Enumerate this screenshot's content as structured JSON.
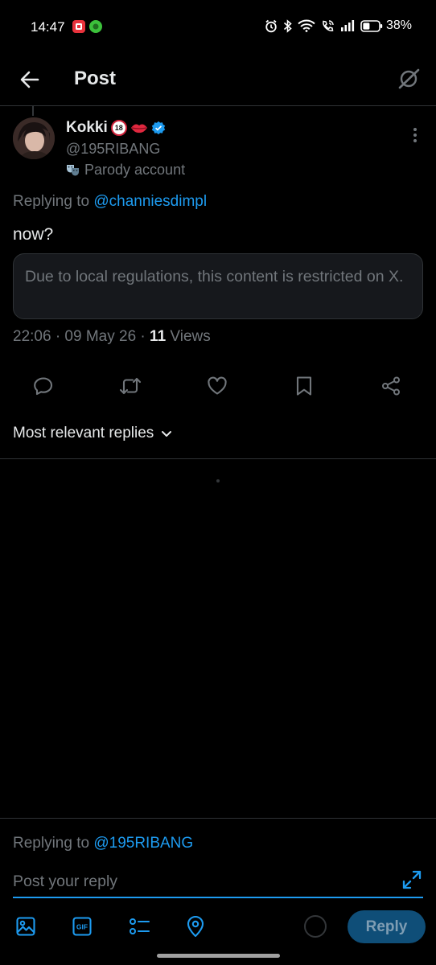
{
  "status_bar": {
    "time": "14:47",
    "battery_percent": "38%",
    "notification_icons": [
      "red-app-icon",
      "green-app-icon"
    ],
    "system_icons": [
      "alarm-icon",
      "bluetooth-icon",
      "wifi-icon",
      "wifi-calling-icon",
      "signal-icon",
      "battery-icon"
    ]
  },
  "header": {
    "title": "Post",
    "back_icon": "arrow-left-icon",
    "grok_icon": "grok-icon"
  },
  "post": {
    "author_name": "Kokki",
    "author_badges": [
      "18-plus-emoji",
      "lips-emoji",
      "verified-badge"
    ],
    "handle": "@195RIBANG",
    "parody_label": "Parody account",
    "replying_prefix": "Replying to ",
    "replying_to": "@channiesdimpl",
    "text": "now?",
    "restricted_notice": "Due to local regulations, this content is restricted on X.",
    "timestamp": "22:06 · 09 May 26 · ",
    "views_count": "11",
    "views_label": " Views"
  },
  "actions": [
    "reply-icon",
    "repost-icon",
    "like-icon",
    "bookmark-icon",
    "share-icon"
  ],
  "replies": {
    "sort_label": "Most relevant replies"
  },
  "composer": {
    "replying_prefix": "Replying to ",
    "replying_to": "@195RIBANG",
    "placeholder": "Post your reply",
    "reply_button": "Reply",
    "tools": [
      "image-icon",
      "gif-icon",
      "poll-icon",
      "location-icon"
    ],
    "gif_label": "GIF"
  },
  "colors": {
    "background": "#000000",
    "accent": "#1d9bf0",
    "text_primary": "#e7e9ea",
    "text_secondary": "#71767b",
    "border": "#2f3336",
    "reply_button_disabled": "#0f4e78"
  }
}
